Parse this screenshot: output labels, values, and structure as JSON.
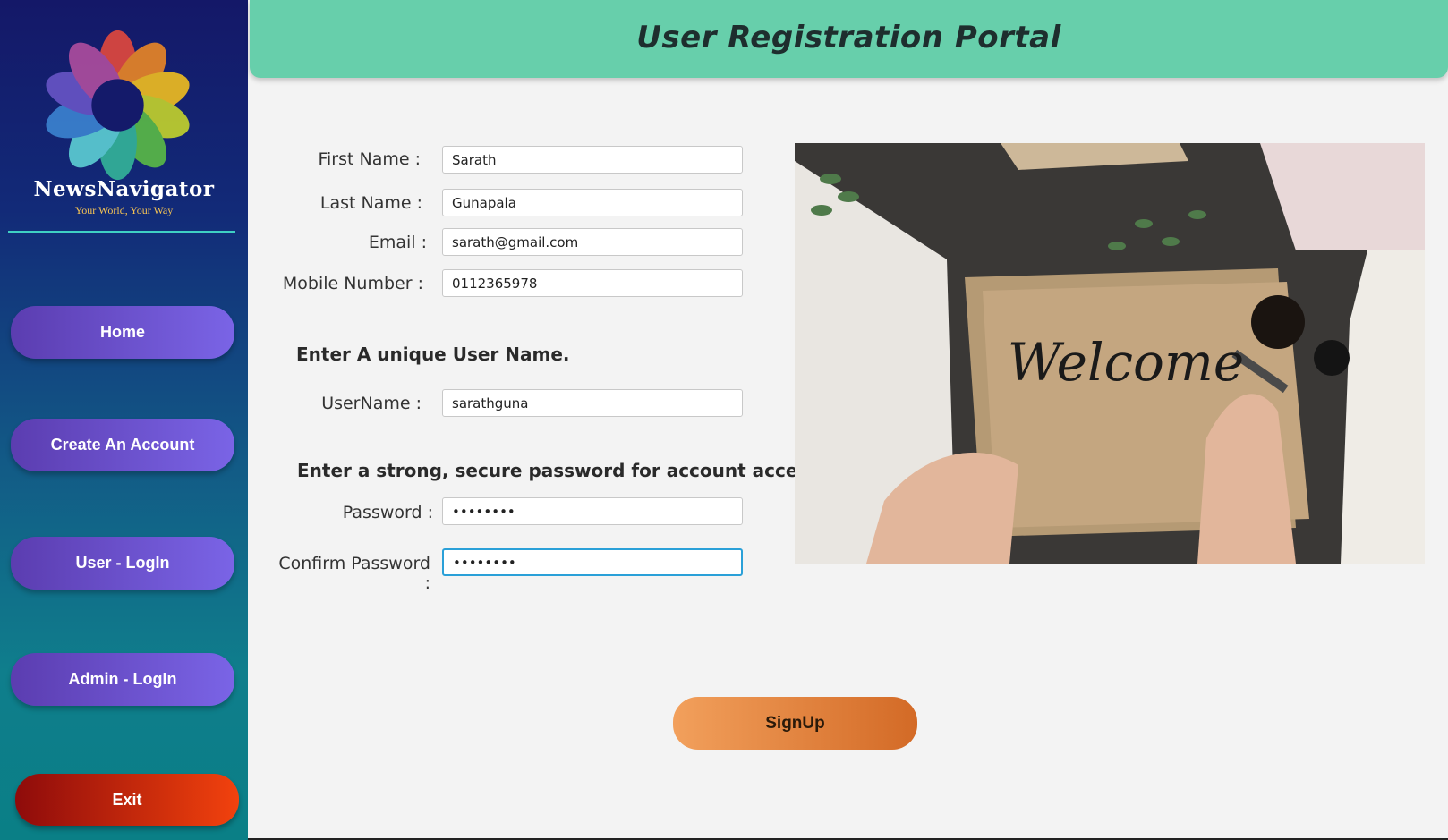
{
  "brand": {
    "name": "NewsNavigator",
    "tagline": "Your World, Your Way"
  },
  "sidebar": {
    "items": [
      {
        "label": "Home"
      },
      {
        "label": "Create An Account"
      },
      {
        "label": "User - LogIn"
      },
      {
        "label": "Admin - LogIn"
      }
    ],
    "exit_label": "Exit"
  },
  "header": {
    "title": "User Registration Portal"
  },
  "form": {
    "first_name": {
      "label": "First Name :",
      "value": "Sarath"
    },
    "last_name": {
      "label": "Last Name :",
      "value": "Gunapala"
    },
    "email": {
      "label": "Email :",
      "value": "sarath@gmail.com"
    },
    "mobile": {
      "label": "Mobile Number :",
      "value": "0112365978"
    },
    "username_heading": "Enter A unique User Name.",
    "username": {
      "label": "UserName :",
      "value": "sarathguna"
    },
    "password_heading": "Enter a strong, secure password for account access.",
    "password": {
      "label": "Password :",
      "value": "••••••••"
    },
    "confirm_password": {
      "label": "Confirm Password :",
      "value": "••••••••"
    }
  },
  "photo": {
    "caption": "Welcome"
  },
  "signup_label": "SignUp",
  "colors": {
    "header_bg": "#67cfab",
    "nav_button": "#6a50cc",
    "exit_button": "#d3300f",
    "signup_button": "#e5873f",
    "focus_border": "#2aa0d8"
  }
}
